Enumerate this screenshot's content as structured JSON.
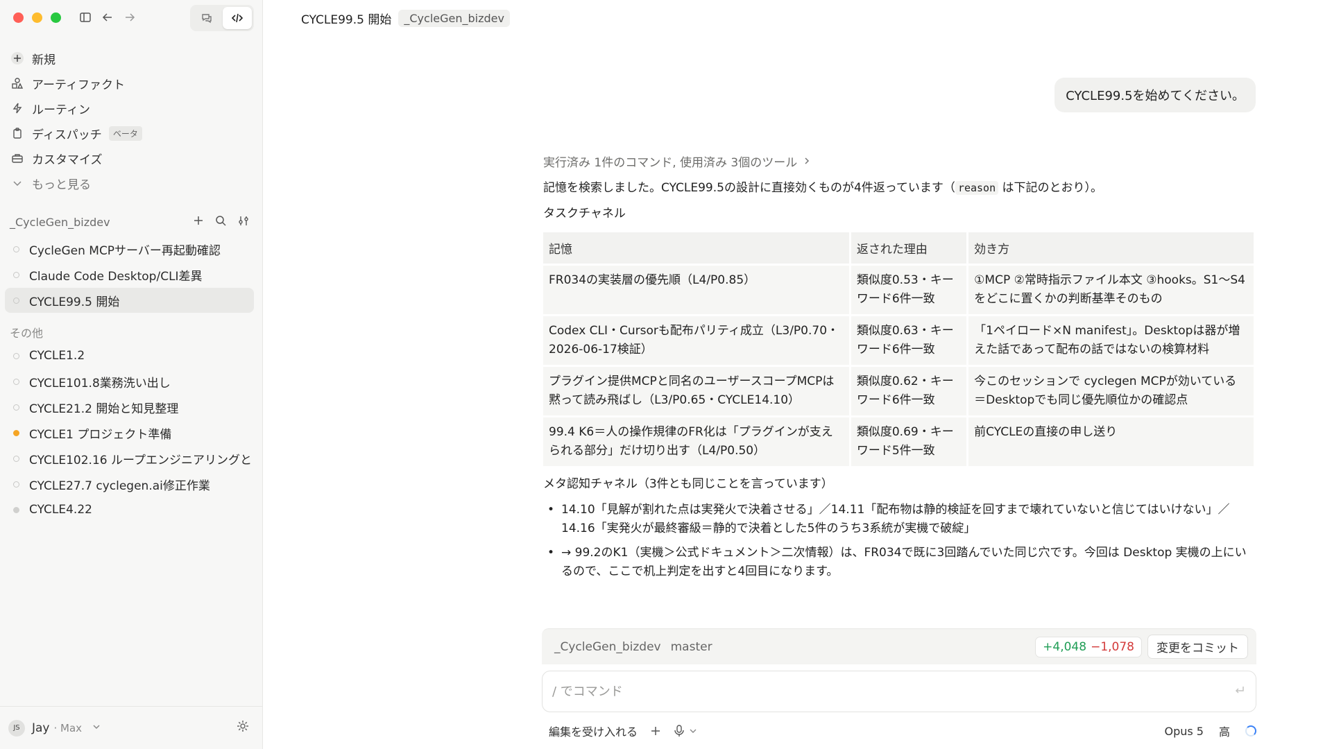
{
  "sidebar": {
    "nav": [
      {
        "label": "新規",
        "icon": "plus-icon"
      },
      {
        "label": "アーティファクト",
        "icon": "shapes-icon"
      },
      {
        "label": "ルーティン",
        "icon": "bolt-icon"
      },
      {
        "label": "ディスパッチ",
        "icon": "clipboard-icon"
      },
      {
        "label": "カスタマイズ",
        "icon": "briefcase-icon"
      },
      {
        "label": "もっと見る",
        "icon": "chevron-down-icon"
      }
    ],
    "dispatch_badge": "ベータ",
    "project_name": "_CycleGen_bizdev",
    "project_sessions": [
      {
        "label": "CycleGen MCPサーバー再起動確認",
        "status": "idle"
      },
      {
        "label": "Claude Code Desktop/CLI差異",
        "status": "idle"
      },
      {
        "label": "CYCLE99.5 開始",
        "status": "active"
      }
    ],
    "other_label": "その他",
    "other_sessions": [
      {
        "label": "CYCLE1.2",
        "status": "idle"
      },
      {
        "label": "CYCLE101.8業務洗い出し",
        "status": "idle"
      },
      {
        "label": "CYCLE21.2 開始と知見整理",
        "status": "idle"
      },
      {
        "label": "CYCLE1 プロジェクト準備",
        "status": "running"
      },
      {
        "label": "CYCLE102.16 ループエンジニアリングと",
        "status": "idle"
      },
      {
        "label": "CYCLE27.7 cyclegen.ai修正作業",
        "status": "idle"
      },
      {
        "label": "CYCLE4.22",
        "status": "done"
      }
    ],
    "user": {
      "initials": "JS",
      "name": "Jay",
      "plan": "· Max"
    }
  },
  "header": {
    "title": "CYCLE99.5 開始",
    "project_chip": "_CycleGen_bizdev"
  },
  "conversation": {
    "user_message": "CYCLE99.5を始めてください。",
    "tools_summary": "実行済み 1件のコマンド, 使用済み 3個のツール",
    "intro_before_code": "記憶を検索しました。CYCLE99.5の設計に直接効くものが4件返っています（",
    "intro_code": "reason",
    "intro_after_code": " は下記のとおり）。",
    "task_channel_label": "タスクチャネル",
    "table": {
      "headers": [
        "記憶",
        "返された理由",
        "効き方"
      ],
      "rows": [
        [
          "FR034の実装層の優先順（L4/P0.85）",
          "類似度0.53・キーワード6件一致",
          "①MCP ②常時指示ファイル本文 ③hooks。S1〜S4をどこに置くかの判断基準そのもの"
        ],
        [
          "Codex CLI・Cursorも配布パリティ成立（L3/P0.70・2026-06-17検証）",
          "類似度0.63・キーワード6件一致",
          "「1ペイロード×N manifest」。Desktopは器が増えた話であって配布の話ではないの検算材料"
        ],
        [
          "プラグイン提供MCPと同名のユーザースコープMCPは黙って読み飛ばし（L3/P0.65・CYCLE14.10）",
          "類似度0.62・キーワード6件一致",
          "今このセッションで cyclegen MCPが効いている＝Desktopでも同じ優先順位かの確認点"
        ],
        [
          "99.4 K6＝人の操作規律のFR化は「プラグインが支えられる部分」だけ切り出す（L4/P0.50）",
          "類似度0.69・キーワード5件一致",
          "前CYCLEの直接の申し送り"
        ]
      ]
    },
    "meta_channel_label": "メタ認知チャネル（3件とも同じことを言っています）",
    "bullets": [
      "14.10「見解が割れた点は実発火で決着させる」／14.11「配布物は静的検証を回すまで壊れていないと信じてはいけない」／14.16「実発火が最終審級＝静的で決着とした5件のうち3系統が実機で破綻」",
      "→ 99.2のK1（実機＞公式ドキュメント＞二次情報）は、FR034で既に3回踏んでいた同じ穴です。今回は Desktop 実機の上にいるので、ここで机上判定を出すと4回目になります。"
    ]
  },
  "repo_bar": {
    "repo": "_CycleGen_bizdev",
    "branch": "master",
    "additions": "+4,048",
    "deletions": "−1,078",
    "commit_label": "変更をコミット"
  },
  "composer": {
    "placeholder": "/ でコマンド",
    "accept_edits": "編集を受け入れる",
    "model": "Opus 5",
    "effort": "高"
  },
  "colors": {
    "additions": "#1f9d55",
    "deletions": "#d33a3a",
    "running_dot": "#f5a524",
    "spinner": "#3b82f6"
  }
}
